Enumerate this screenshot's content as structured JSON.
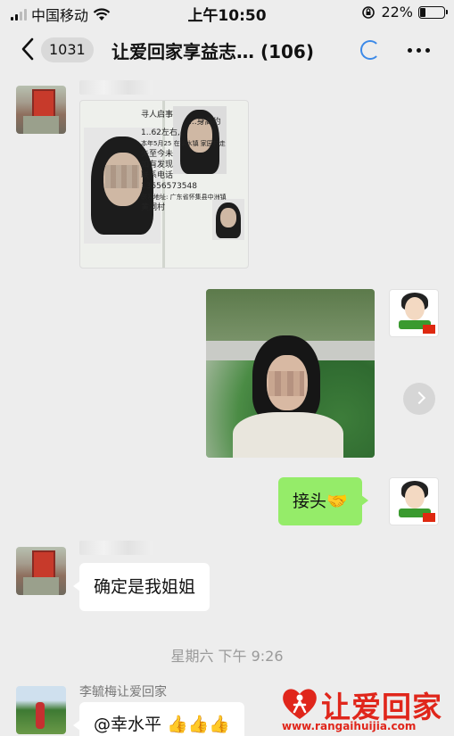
{
  "status_bar": {
    "carrier": "中国移动",
    "time": "上午10:50",
    "battery": "22%",
    "battery_level": 0.22
  },
  "nav": {
    "unread_count": "1031",
    "title": "让爱回家享益志… (106)"
  },
  "messages": {
    "id_card": {
      "lines": [
        "寻人启事",
        "...身高约",
        "1..62左右,",
        "本年5月25 在涂水镇 家园村走",
        "失至今未",
        "如有发现",
        "联系电话",
        "13556573548",
        "联系地址: 广东省怀集县中洲镇",
        "黄洞村"
      ]
    },
    "reply_1": "接头🤝",
    "reply_2": "确定是我姐姐"
  },
  "timestamp": "星期六 下午 9:26",
  "sender_name": "李毓梅让爱回家",
  "last_message": "@幸水平 👍👍👍",
  "watermark": {
    "text": "让爱回家",
    "url": "www.rangaihuijia.com",
    "color": "#e0261b"
  },
  "colors": {
    "bubble_green": "#95ec69",
    "background": "#ededed",
    "loader": "#3b89e8"
  }
}
